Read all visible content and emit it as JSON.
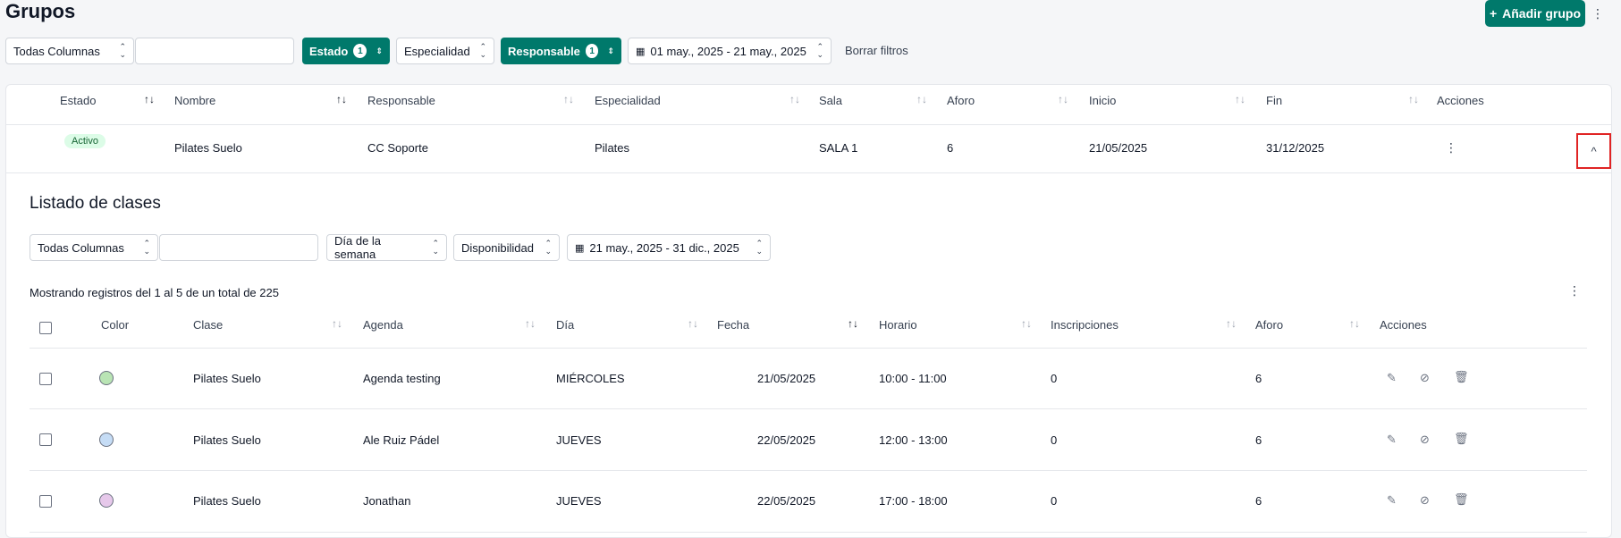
{
  "header": {
    "title": "Grupos",
    "add_button": "Añadir grupo",
    "add_icon": "+",
    "more_icon": "⋮"
  },
  "filters": {
    "columns_select": "Todas Columnas",
    "search_value": "",
    "estado": {
      "label": "Estado",
      "count": "1"
    },
    "especialidad": "Especialidad",
    "responsable": {
      "label": "Responsable",
      "count": "1"
    },
    "date_range": "01 may., 2025 - 21 may., 2025",
    "clear": "Borrar filtros"
  },
  "groups_table": {
    "columns": [
      "Estado",
      "Nombre",
      "Responsable",
      "Especialidad",
      "Sala",
      "Aforo",
      "Inicio",
      "Fin",
      "Acciones"
    ],
    "row": {
      "estado": "Activo",
      "nombre": "Pilates Suelo",
      "responsable": "CC Soporte",
      "especialidad": "Pilates",
      "sala": "SALA 1",
      "aforo": "6",
      "inicio": "21/05/2025",
      "fin": "31/12/2025",
      "actions_icon": "⋮",
      "collapse_icon": "^"
    }
  },
  "classes": {
    "title": "Listado de clases",
    "filters": {
      "columns_select": "Todas Columnas",
      "search_value": "",
      "weekday": "Día de la semana",
      "availability": "Disponibilidad",
      "date_range": "21 may., 2025 - 31 dic., 2025"
    },
    "summary": "Mostrando registros del 1 al 5 de un total de 225",
    "more_icon": "⋮",
    "columns": [
      "Color",
      "Clase",
      "Agenda",
      "Día",
      "Fecha",
      "Horario",
      "Inscripciones",
      "Aforo",
      "Acciones"
    ],
    "rows": [
      {
        "color": "#b9e4b4",
        "clase": "Pilates Suelo",
        "agenda": "Agenda testing",
        "dia": "MIÉRCOLES",
        "fecha": "21/05/2025",
        "horario": "10:00 - 11:00",
        "inscripciones": "0",
        "aforo": "6"
      },
      {
        "color": "#c5dcf5",
        "clase": "Pilates Suelo",
        "agenda": "Ale Ruiz Pádel",
        "dia": "JUEVES",
        "fecha": "22/05/2025",
        "horario": "12:00 - 13:00",
        "inscripciones": "0",
        "aforo": "6"
      },
      {
        "color": "#e6c8ea",
        "clase": "Pilates Suelo",
        "agenda": "Jonathan",
        "dia": "JUEVES",
        "fecha": "22/05/2025",
        "horario": "17:00 - 18:00",
        "inscripciones": "0",
        "aforo": "6"
      }
    ],
    "action_icons": {
      "edit": "✎",
      "cancel": "⊘",
      "delete": "🗑"
    }
  },
  "colors": {
    "primary": "#00796b",
    "highlight": "#e02424"
  }
}
